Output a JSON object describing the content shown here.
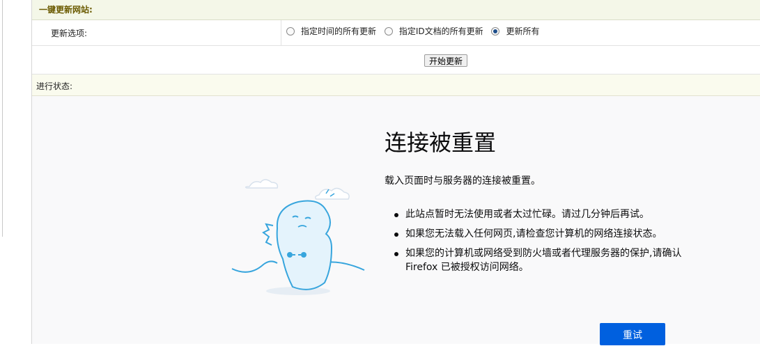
{
  "panel": {
    "title": "一键更新网站:",
    "options_label": "更新选项:",
    "radios": [
      {
        "label": "指定时间的所有更新",
        "checked": false
      },
      {
        "label": "指定ID文档的所有更新",
        "checked": false
      },
      {
        "label": "更新所有",
        "checked": true
      }
    ],
    "start_button": "开始更新",
    "status_label": "进行状态:"
  },
  "error_page": {
    "title": "连接被重置",
    "description": "载入页面时与服务器的连接被重置。",
    "bullets": [
      "此站点暂时无法使用或者太过忙碌。请过几分钟后再试。",
      "如果您无法载入任何网页,请检查您计算机的网络连接状态。",
      "如果您的计算机或网络受到防火墙或者代理服务器的保护,请确认 Firefox 已被授权访问网络。"
    ],
    "retry_button": "重试",
    "illustration_icon": "sad-dino-unplugged-icon"
  },
  "colors": {
    "title_bar_bg": "#f4f7e8",
    "title_text": "#6a5a00",
    "retry_button_bg": "#0060df",
    "error_frame_bg": "#f9f9fa"
  }
}
